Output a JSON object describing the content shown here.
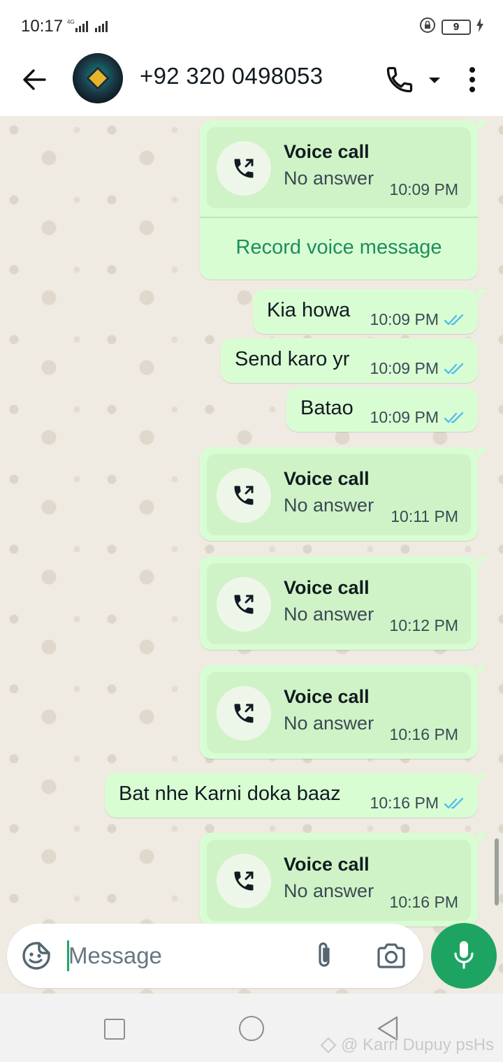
{
  "status_bar": {
    "time": "10:17",
    "network": "4G",
    "battery": "9"
  },
  "header": {
    "contact_name": "+92 320 0498053"
  },
  "colors": {
    "bubble_out": "#d9fdd3",
    "call_card": "#cff3c6",
    "accent_green": "#1ea462",
    "link_green": "#1d8d5c",
    "tick_blue": "#53bdeb"
  },
  "messages": [
    {
      "type": "call",
      "title": "Voice call",
      "status": "No answer",
      "time": "10:09 PM",
      "action": "Record voice message"
    },
    {
      "type": "text",
      "text": "Kia howa",
      "time": "10:09 PM"
    },
    {
      "type": "text",
      "text": "Send karo yr",
      "time": "10:09 PM"
    },
    {
      "type": "text",
      "text": "Batao",
      "time": "10:09 PM"
    },
    {
      "type": "call",
      "title": "Voice call",
      "status": "No answer",
      "time": "10:11 PM"
    },
    {
      "type": "call",
      "title": "Voice call",
      "status": "No answer",
      "time": "10:12 PM"
    },
    {
      "type": "call",
      "title": "Voice call",
      "status": "No answer",
      "time": "10:16 PM"
    },
    {
      "type": "text",
      "text": "Bat nhe Karni doka baaz",
      "time": "10:16 PM"
    },
    {
      "type": "call",
      "title": "Voice call",
      "status": "No answer",
      "time": "10:16 PM"
    }
  ],
  "composer": {
    "placeholder": "Message"
  },
  "watermark": "@ Karri Dupuy psHs"
}
